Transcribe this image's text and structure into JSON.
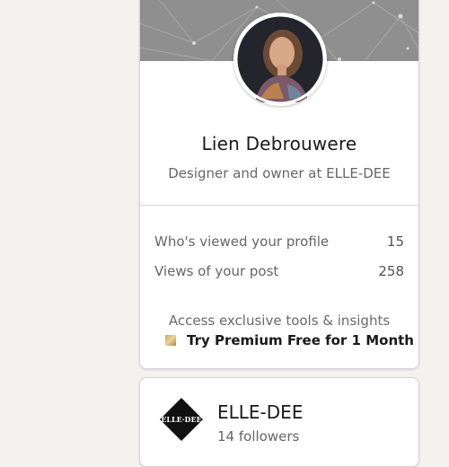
{
  "profile": {
    "name": "Lien Debrouwere",
    "headline": "Designer and owner at ELLE-DEE",
    "avatar_alt": "profile photo"
  },
  "stats": [
    {
      "label": "Who's viewed your profile",
      "value": "15"
    },
    {
      "label": "Views of your post",
      "value": "258"
    }
  ],
  "premium": {
    "teaser": "Access exclusive tools & insights",
    "cta": "Try Premium Free for 1 Month",
    "icon": "premium-gold-square-icon"
  },
  "company": {
    "name": "ELLE-DEE",
    "followers": "14 followers",
    "logo_text": "ELLEDEE"
  },
  "colors": {
    "banner": "#8f8f8f",
    "background": "#f3f2ef",
    "accent_gold": "#c9a86a"
  }
}
